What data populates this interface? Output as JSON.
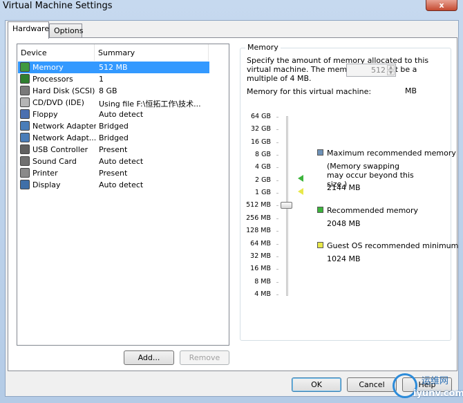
{
  "window": {
    "title": "Virtual Machine Settings",
    "close_glyph": "x"
  },
  "tabs": [
    {
      "label": "Hardware"
    },
    {
      "label": "Options"
    }
  ],
  "device_list": {
    "headers": {
      "device": "Device",
      "summary": "Summary"
    },
    "rows": [
      {
        "device": "Memory",
        "summary": "512 MB",
        "icon": "memory-icon",
        "selected": true
      },
      {
        "device": "Processors",
        "summary": "1",
        "icon": "processor-icon"
      },
      {
        "device": "Hard Disk (SCSI)",
        "summary": "8 GB",
        "icon": "hard-disk-icon"
      },
      {
        "device": "CD/DVD (IDE)",
        "summary": "Using file F:\\恒拓工作\\技术...",
        "icon": "cd-dvd-icon"
      },
      {
        "device": "Floppy",
        "summary": "Auto detect",
        "icon": "floppy-icon"
      },
      {
        "device": "Network Adapter",
        "summary": "Bridged",
        "icon": "network-adapter-icon"
      },
      {
        "device": "Network Adapt...",
        "summary": "Bridged",
        "icon": "network-adapter-icon"
      },
      {
        "device": "USB Controller",
        "summary": "Present",
        "icon": "usb-icon"
      },
      {
        "device": "Sound Card",
        "summary": "Auto detect",
        "icon": "sound-card-icon"
      },
      {
        "device": "Printer",
        "summary": "Present",
        "icon": "printer-icon"
      },
      {
        "device": "Display",
        "summary": "Auto detect",
        "icon": "display-icon"
      }
    ]
  },
  "list_buttons": {
    "add": "Add...",
    "remove": "Remove"
  },
  "memory": {
    "group_title": "Memory",
    "description": "Specify the amount of memory allocated to this virtual machine. The memory size must be a multiple of 4 MB.",
    "field_label": "Memory for this virtual machine:",
    "field_value": "512",
    "unit": "MB",
    "scale_labels": [
      "64 GB",
      "32 GB",
      "16 GB",
      "8 GB",
      "4 GB",
      "2 GB",
      "1 GB",
      "512 MB",
      "256 MB",
      "128 MB",
      "64 MB",
      "32 MB",
      "16 MB",
      "8 MB",
      "4 MB"
    ],
    "slider_value_mb": 512,
    "legend": [
      {
        "label": "Maximum recommended memory",
        "note": "(Memory swapping may occur beyond this size.)",
        "value": "2144 MB",
        "color": "#6f93b8"
      },
      {
        "label": "Recommended memory",
        "note": "",
        "value": "2048 MB",
        "color": "#3cb43c"
      },
      {
        "label": "Guest OS recommended minimum",
        "note": "",
        "value": "1024 MB",
        "color": "#e8e84a"
      }
    ]
  },
  "footer": {
    "ok": "OK",
    "cancel": "Cancel",
    "help": "Help"
  },
  "watermark": {
    "text": "运维网",
    "subtext": "iyunv.com"
  }
}
